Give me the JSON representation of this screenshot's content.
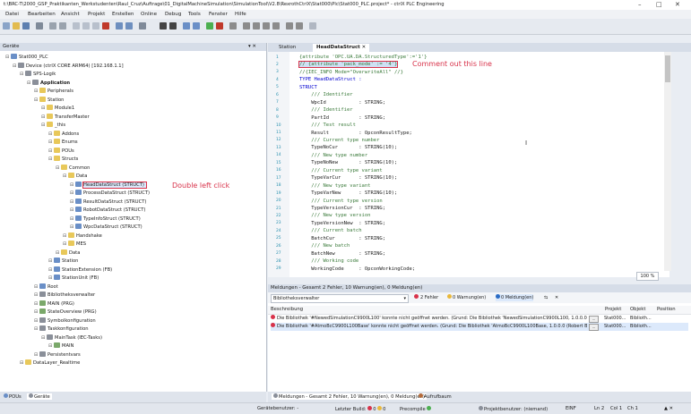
{
  "window": {
    "title": "t:\\BRC-T\\2000_GSP_Praktikanten_Werkstudenten\\Raul_Cruz\\Auftrage\\01_DigitalMachineSimulation\\SimulationTool\\V2.8\\RexrothCtrlX\\Stat000\\Plc\\Stat000_PLC.project* - ctrlX PLC Engineering",
    "controls": [
      "–",
      "□",
      "✕"
    ]
  },
  "menu": [
    "Datei",
    "Bearbeiten",
    "Ansicht",
    "Projekt",
    "Erstellen",
    "Online",
    "Debug",
    "Tools",
    "Fenster",
    "Hilfe"
  ],
  "devices_panel": {
    "title": "Geräte",
    "tree": [
      {
        "label": "Stat000_PLC",
        "level": 0,
        "icon": "project-icon"
      },
      {
        "label": "Device (ctrlX CORE ARM64) [192.168.1.1]",
        "level": 1,
        "icon": "device-icon"
      },
      {
        "label": "SPS-Logik",
        "level": 2,
        "icon": "plc-logic-icon"
      },
      {
        "label": "Application",
        "level": 3,
        "icon": "application-icon",
        "bold": true
      },
      {
        "label": "Peripherals",
        "level": 4,
        "icon": "folder-icon"
      },
      {
        "label": "Station",
        "level": 4,
        "icon": "folder-icon"
      },
      {
        "label": "Module1",
        "level": 5,
        "icon": "folder-icon"
      },
      {
        "label": "TransferMaster",
        "level": 5,
        "icon": "folder-icon"
      },
      {
        "label": "_this",
        "level": 5,
        "icon": "folder-icon"
      },
      {
        "label": "Addons",
        "level": 6,
        "icon": "folder-icon"
      },
      {
        "label": "Enums",
        "level": 6,
        "icon": "folder-icon"
      },
      {
        "label": "POUs",
        "level": 6,
        "icon": "folder-icon"
      },
      {
        "label": "Structs",
        "level": 6,
        "icon": "folder-icon"
      },
      {
        "label": "Common",
        "level": 7,
        "icon": "folder-icon"
      },
      {
        "label": "Data",
        "level": 8,
        "icon": "folder-icon"
      },
      {
        "label": "HeadDataStruct (STRUCT)",
        "level": 9,
        "icon": "struct-icon",
        "selected": true
      },
      {
        "label": "ProcessDataStruct (STRUCT)",
        "level": 9,
        "icon": "struct-icon"
      },
      {
        "label": "ResultDataStruct (STRUCT)",
        "level": 9,
        "icon": "struct-icon"
      },
      {
        "label": "RobotDataStruct (STRUCT)",
        "level": 9,
        "icon": "struct-icon"
      },
      {
        "label": "TypeInfoStruct (STRUCT)",
        "level": 9,
        "icon": "struct-icon"
      },
      {
        "label": "WpcDataStruct (STRUCT)",
        "level": 9,
        "icon": "struct-icon"
      },
      {
        "label": "Handshake",
        "level": 8,
        "icon": "folder-icon"
      },
      {
        "label": "MES",
        "level": 8,
        "icon": "folder-icon"
      },
      {
        "label": "Data",
        "level": 7,
        "icon": "folder-icon"
      },
      {
        "label": "Station",
        "level": 6,
        "icon": "block-icon"
      },
      {
        "label": "StationExtension (FB)",
        "level": 6,
        "icon": "block-icon"
      },
      {
        "label": "StationUnit (FB)",
        "level": 6,
        "icon": "block-icon"
      },
      {
        "label": "Root",
        "level": 4,
        "icon": "block-icon"
      },
      {
        "label": "Bibliotheksverwalter",
        "level": 4,
        "icon": "library-icon"
      },
      {
        "label": "MAIN (PRG)",
        "level": 4,
        "icon": "program-icon"
      },
      {
        "label": "StateOverview (PRG)",
        "level": 4,
        "icon": "program-icon"
      },
      {
        "label": "Symbolkonfiguration",
        "level": 4,
        "icon": "symbol-icon"
      },
      {
        "label": "Taskkonfiguration",
        "level": 4,
        "icon": "task-icon"
      },
      {
        "label": "MainTask (IEC-Tasks)",
        "level": 5,
        "icon": "task-icon"
      },
      {
        "label": "MAIN",
        "level": 6,
        "icon": "program-icon"
      },
      {
        "label": "Persistentvars",
        "level": 4,
        "icon": "vars-icon"
      },
      {
        "label": "DataLayer_Realtime",
        "level": 2,
        "icon": "folder-icon"
      }
    ]
  },
  "annotations": {
    "comment_out": "Comment out this line",
    "double_click": "Double left click"
  },
  "editor": {
    "tabs": [
      {
        "label": "Station",
        "active": false
      },
      {
        "label": "HeadDataStruct",
        "active": true
      }
    ],
    "zoom": "100 %",
    "lines": [
      {
        "n": "1",
        "text": "{attribute 'OPC.UA.DA.StructuredType':='1'}",
        "kind": "attr"
      },
      {
        "n": "2",
        "text": "// {attribute 'pack_mode' := '4'}",
        "kind": "highlight"
      },
      {
        "n": "3",
        "text": "//{IEC_INFO Mode=\"OverwriteAll\" //}",
        "kind": "comment"
      },
      {
        "n": "4",
        "text": "TYPE HeadDataStruct :",
        "kind": "kw"
      },
      {
        "n": "5",
        "text": "STRUCT",
        "kind": "kw"
      },
      {
        "n": "6",
        "text": "    /// Identifier",
        "kind": "comment"
      },
      {
        "n": "7",
        "text": "    WpcId           : STRING;",
        "kind": "decl"
      },
      {
        "n": "8",
        "text": "    /// Identifier",
        "kind": "comment"
      },
      {
        "n": "9",
        "text": "    PartId          : STRING;",
        "kind": "decl"
      },
      {
        "n": "10",
        "text": "    /// Test result",
        "kind": "comment"
      },
      {
        "n": "11",
        "text": "    Result          : OpconResultType;",
        "kind": "decl"
      },
      {
        "n": "12",
        "text": "    /// Current type number",
        "kind": "comment"
      },
      {
        "n": "13",
        "text": "    TypeNoCur       : STRING(10);",
        "kind": "decl"
      },
      {
        "n": "14",
        "text": "    /// New type number",
        "kind": "comment"
      },
      {
        "n": "15",
        "text": "    TypeNoNew       : STRING(10);",
        "kind": "decl"
      },
      {
        "n": "16",
        "text": "    /// Current type variant",
        "kind": "comment"
      },
      {
        "n": "17",
        "text": "    TypeVarCur      : STRING(10);",
        "kind": "decl"
      },
      {
        "n": "18",
        "text": "    /// New type variant",
        "kind": "comment"
      },
      {
        "n": "19",
        "text": "    TypeVarNew      : STRING(10);",
        "kind": "decl"
      },
      {
        "n": "20",
        "text": "    /// Current type version",
        "kind": "comment"
      },
      {
        "n": "21",
        "text": "    TypeVersionCur  : STRING;",
        "kind": "decl"
      },
      {
        "n": "22",
        "text": "    /// New type version",
        "kind": "comment"
      },
      {
        "n": "23",
        "text": "    TypeVersionNew  : STRING;",
        "kind": "decl"
      },
      {
        "n": "24",
        "text": "    /// Current batch",
        "kind": "comment"
      },
      {
        "n": "25",
        "text": "    BatchCur        : STRING;",
        "kind": "decl"
      },
      {
        "n": "26",
        "text": "    /// New batch",
        "kind": "comment"
      },
      {
        "n": "27",
        "text": "    BatchNew        : STRING;",
        "kind": "decl"
      },
      {
        "n": "28",
        "text": "    /// Working code",
        "kind": "comment"
      },
      {
        "n": "29",
        "text": "    WorkingCode     : OpconWorkingCode;",
        "kind": "decl"
      }
    ]
  },
  "messages": {
    "title": "Meldungen - Gesamt 2 Fehler, 10 Warnung(en), 0 Meldung(en)",
    "source": "Bibliotheksverwalter",
    "counts": {
      "errors": "2 Fehler",
      "warnings": "0 Warnung(en)",
      "messages": "0 Meldung(en)"
    },
    "columns": [
      "Beschreibung",
      "Projekt",
      "Objekt",
      "Position"
    ],
    "rows": [
      {
        "text": "Die Bibliothek '#NewedSimulationC9900L100' konnte nicht geöffnet werden. (Grund: Die Bibliothek 'NewedSimulationC9900L100, 1.0.0.0 (...', ...",
        "project": "Stat000...",
        "object": "Biblioth..."
      },
      {
        "text": "Die Bibliothek '#AtmoBcC9900L100Base' konnte nicht geöffnet werden. (Grund: Die Bibliothek 'AtmoBcC9900L100Base, 1.0.0.0 (Robert Bos...",
        "project": "Stat000...",
        "object": "Biblioth..."
      }
    ]
  },
  "bottom_tabs_left": [
    "POUs",
    "Geräte"
  ],
  "bottom_tabs_right": [
    "Meldungen - Gesamt 2 Fehler, 10 Warnung(en), 0 Meldung(en)",
    "Aufrufbaum"
  ],
  "status": {
    "user": "Gerätebenutzer: -",
    "last_build_label": "Letzter Build:",
    "errors": "0",
    "warnings": "0",
    "precompile": "Precompile",
    "project_user": "Projektbenutzer: (niemand)",
    "mode": "EINF",
    "line": "Ln 2",
    "col": "Col 1",
    "ch": "Ch 1"
  },
  "colors": {
    "accent": "#d8324a",
    "keyword": "#0000d0",
    "comment": "#3a7a3a",
    "selection": "#dce9fb"
  }
}
